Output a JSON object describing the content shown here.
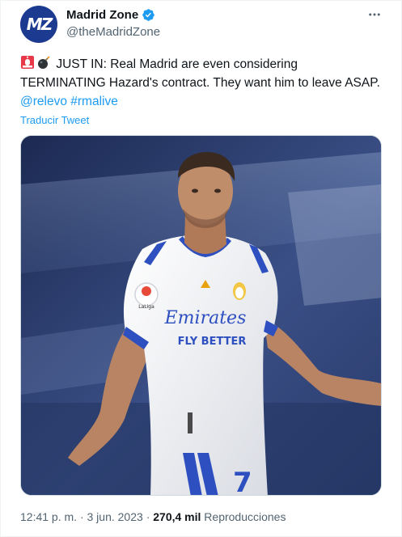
{
  "account": {
    "name": "Madrid Zone",
    "handle": "@theMadridZone",
    "avatar_text": "MZ",
    "verified_icon": "verified-badge-icon"
  },
  "tweet": {
    "text_main": "JUST IN: Real Madrid are even considering TERMINATING Hazard's contract. They want him to leave ASAP.",
    "mention": "@relevo",
    "hashtag": "#rmalive",
    "translate_label": "Traducir Tweet"
  },
  "meta": {
    "time": "12:41 p. m.",
    "separator": "·",
    "date": "3 jun. 2023",
    "views_count": "270,4 mil",
    "views_label": "Reproducciones"
  },
  "colors": {
    "link": "#1d9bf0",
    "text": "#0f1419",
    "secondary": "#536471",
    "avatar_bg": "#1c3a8f"
  },
  "jersey": {
    "brand": "Emirates",
    "sub": "FLY BETTER",
    "number": "7",
    "patch": "LaLiga"
  }
}
